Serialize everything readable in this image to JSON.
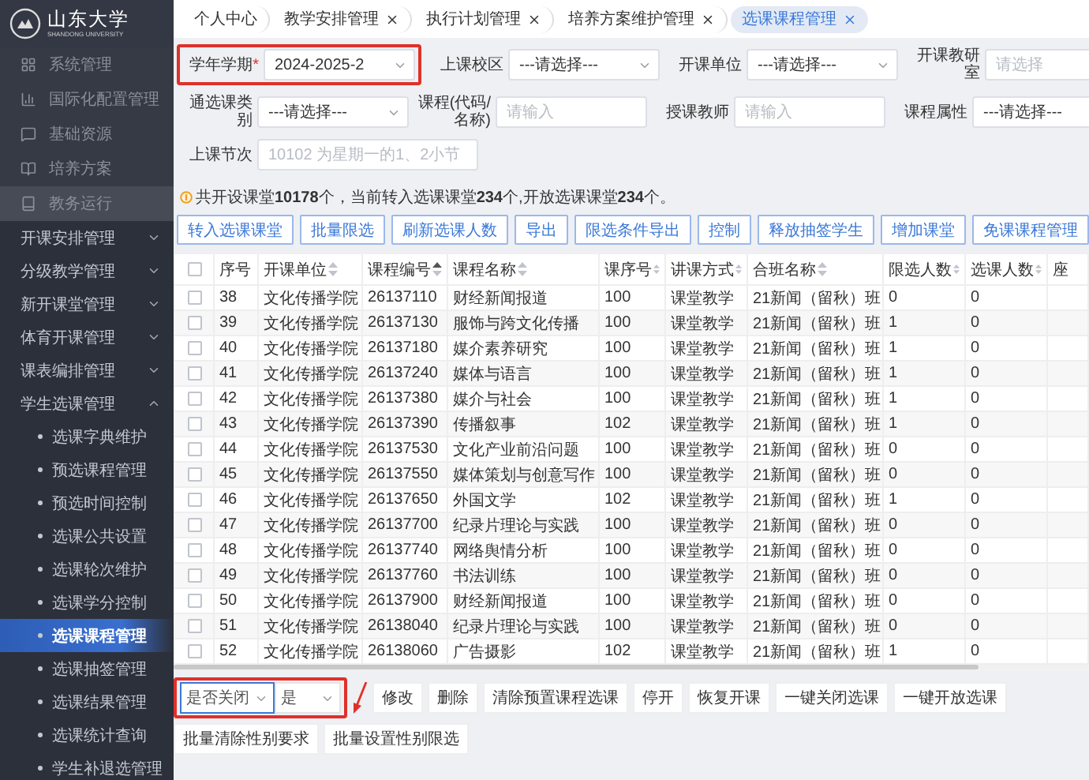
{
  "logo": {
    "name": "山东大学",
    "subtitle": "SHANDONG UNIVERSITY"
  },
  "sidebar": {
    "top_items": [
      {
        "label": "系统管理",
        "selected": false
      },
      {
        "label": "国际化配置管理",
        "selected": false
      },
      {
        "label": "基础资源",
        "selected": false
      },
      {
        "label": "培养方案",
        "selected": false
      },
      {
        "label": "教务运行",
        "selected": true
      }
    ],
    "groups": [
      {
        "label": "开课安排管理",
        "expanded": false
      },
      {
        "label": "分级教学管理",
        "expanded": false
      },
      {
        "label": "新开课堂管理",
        "expanded": false
      },
      {
        "label": "体育开课管理",
        "expanded": false
      },
      {
        "label": "课表编排管理",
        "expanded": false
      },
      {
        "label": "学生选课管理",
        "expanded": true,
        "children": [
          {
            "label": "选课字典维护",
            "selected": false
          },
          {
            "label": "预选课程管理",
            "selected": false
          },
          {
            "label": "预选时间控制",
            "selected": false
          },
          {
            "label": "选课公共设置",
            "selected": false
          },
          {
            "label": "选课轮次维护",
            "selected": false
          },
          {
            "label": "选课学分控制",
            "selected": false
          },
          {
            "label": "选课课程管理",
            "selected": true
          },
          {
            "label": "选课抽签管理",
            "selected": false
          },
          {
            "label": "选课结果管理",
            "selected": false
          },
          {
            "label": "选课统计查询",
            "selected": false
          },
          {
            "label": "学生补退选管理",
            "selected": false
          }
        ]
      }
    ]
  },
  "tabs": [
    {
      "label": "个人中心",
      "closable": false,
      "selected": false
    },
    {
      "label": "教学安排管理",
      "closable": true,
      "selected": false
    },
    {
      "label": "执行计划管理",
      "closable": true,
      "selected": false
    },
    {
      "label": "培养方案维护管理",
      "closable": true,
      "selected": false
    },
    {
      "label": "选课课程管理",
      "closable": true,
      "selected": true
    }
  ],
  "filters": [
    [
      {
        "label": "学年学期",
        "required_mark": "*",
        "kind": "select",
        "value": "2024-2025-2"
      },
      {
        "label": "上课校区",
        "kind": "select",
        "value": "---请选择---"
      },
      {
        "label": "开课单位",
        "kind": "select",
        "value": "---请选择---"
      },
      {
        "label": "开课教研室",
        "kind": "select",
        "placeholder": "请选择"
      }
    ],
    [
      {
        "label": "通选课类别",
        "kind": "select",
        "value": "---请选择---"
      },
      {
        "label": "课程(代码/名称)",
        "kind": "input",
        "placeholder": "请输入"
      },
      {
        "label": "授课教师",
        "kind": "input",
        "placeholder": "请输入"
      },
      {
        "label": "课程属性",
        "kind": "select",
        "value": "---请选择---"
      }
    ],
    [
      {
        "label": "上课节次",
        "kind": "input",
        "placeholder": "10102 为星期一的1、2小节"
      }
    ]
  ],
  "summary": "共开设课堂**10178**个，当前转入选课课堂**234**个,开放选课课堂**234**个。",
  "toolbar": [
    "转入选课课堂",
    "批量限选",
    "刷新选课人数",
    "导出",
    "限选条件导出",
    "控制",
    "释放抽签学生",
    "增加课堂",
    "免课课程管理"
  ],
  "table": {
    "all_checked": false,
    "columns": [
      {
        "label": "序号"
      },
      {
        "label": "开课单位",
        "sorted": false
      },
      {
        "label": "课程编号",
        "sorted": true
      },
      {
        "label": "课程名称",
        "sorted": false
      },
      {
        "label": "课序号",
        "sorted": false
      },
      {
        "label": "讲课方式",
        "sorted": false
      },
      {
        "label": "合班名称",
        "sorted": false
      },
      {
        "label": "限选人数",
        "sorted": false
      },
      {
        "label": "选课人数",
        "sorted": false
      },
      {
        "label": "座"
      }
    ],
    "rows": [
      {
        "checked": false,
        "cells": [
          "38",
          "文化传播学院",
          "26137110",
          "财经新闻报道",
          "100",
          "课堂教学",
          "21新闻（留秋）班",
          "0",
          "0"
        ]
      },
      {
        "checked": false,
        "cells": [
          "39",
          "文化传播学院",
          "26137130",
          "服饰与跨文化传播",
          "100",
          "课堂教学",
          "21新闻（留秋）班",
          "1",
          "0"
        ]
      },
      {
        "checked": false,
        "cells": [
          "40",
          "文化传播学院",
          "26137180",
          "媒介素养研究",
          "100",
          "课堂教学",
          "21新闻（留秋）班",
          "1",
          "0"
        ]
      },
      {
        "checked": false,
        "cells": [
          "41",
          "文化传播学院",
          "26137240",
          "媒体与语言",
          "100",
          "课堂教学",
          "21新闻（留秋）班",
          "1",
          "0"
        ]
      },
      {
        "checked": false,
        "cells": [
          "42",
          "文化传播学院",
          "26137380",
          "媒介与社会",
          "100",
          "课堂教学",
          "21新闻（留秋）班",
          "1",
          "0"
        ]
      },
      {
        "checked": false,
        "cells": [
          "43",
          "文化传播学院",
          "26137390",
          "传播叙事",
          "102",
          "课堂教学",
          "21新闻（留秋）班",
          "1",
          "0"
        ]
      },
      {
        "checked": false,
        "cells": [
          "44",
          "文化传播学院",
          "26137530",
          "文化产业前沿问题",
          "100",
          "课堂教学",
          "21新闻（留秋）班",
          "0",
          "0"
        ]
      },
      {
        "checked": false,
        "cells": [
          "45",
          "文化传播学院",
          "26137550",
          "媒体策划与创意写作",
          "100",
          "课堂教学",
          "21新闻（留秋）班",
          "0",
          "0"
        ]
      },
      {
        "checked": false,
        "cells": [
          "46",
          "文化传播学院",
          "26137650",
          "外国文学",
          "102",
          "课堂教学",
          "21新闻（留秋）班",
          "1",
          "0"
        ]
      },
      {
        "checked": false,
        "cells": [
          "47",
          "文化传播学院",
          "26137700",
          "纪录片理论与实践",
          "100",
          "课堂教学",
          "21新闻（留秋）班",
          "0",
          "0"
        ]
      },
      {
        "checked": false,
        "cells": [
          "48",
          "文化传播学院",
          "26137740",
          "网络舆情分析",
          "100",
          "课堂教学",
          "21新闻（留秋）班",
          "0",
          "0"
        ]
      },
      {
        "checked": false,
        "cells": [
          "49",
          "文化传播学院",
          "26137760",
          "书法训练",
          "100",
          "课堂教学",
          "21新闻（留秋）班",
          "0",
          "0"
        ]
      },
      {
        "checked": false,
        "cells": [
          "50",
          "文化传播学院",
          "26137900",
          "财经新闻报道",
          "100",
          "课堂教学",
          "21新闻（留秋）班",
          "0",
          "0"
        ]
      },
      {
        "checked": false,
        "cells": [
          "51",
          "文化传播学院",
          "26138040",
          "纪录片理论与实践",
          "100",
          "课堂教学",
          "21新闻（留秋）班",
          "0",
          "0"
        ]
      },
      {
        "checked": false,
        "cells": [
          "52",
          "文化传播学院",
          "26138060",
          "广告摄影",
          "102",
          "课堂教学",
          "21新闻（留秋）班",
          "1",
          "0"
        ]
      }
    ]
  },
  "bottom": {
    "selects": [
      "是否关闭",
      "是"
    ],
    "buttons": [
      "修改",
      "删除",
      "清除预置课程选课",
      "停开",
      "恢复开课",
      "一键关闭选课",
      "一键开放选课",
      "批量清除性别要求",
      "批量设置性别限选"
    ]
  }
}
